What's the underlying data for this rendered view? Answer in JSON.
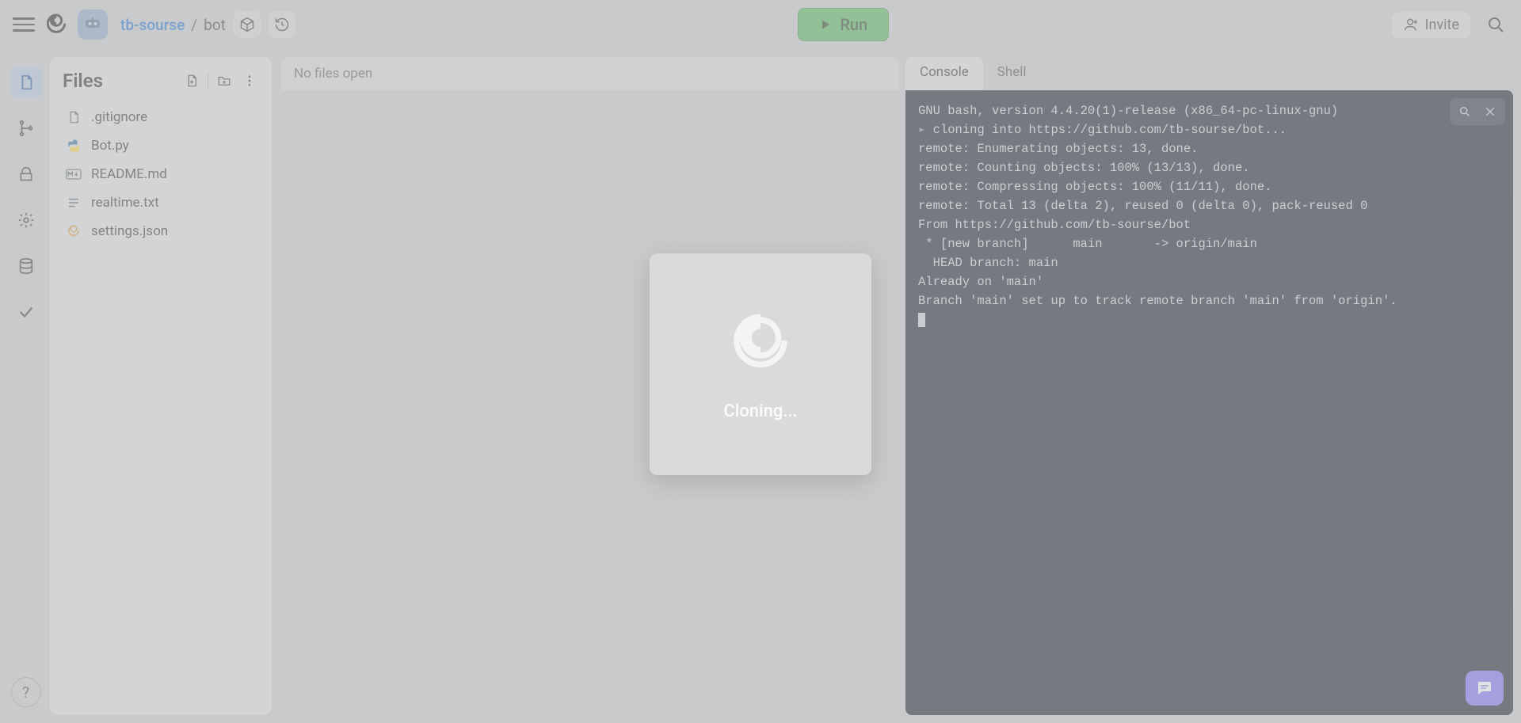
{
  "header": {
    "owner": "tb-sourse",
    "separator": "/",
    "repo": "bot",
    "run_label": "Run",
    "invite_label": "Invite"
  },
  "sidebar_rail": {
    "items": [
      "files",
      "version-control",
      "secrets",
      "settings",
      "database",
      "tests"
    ]
  },
  "files_panel": {
    "title": "Files",
    "items": [
      {
        "name": ".gitignore",
        "icon": "file"
      },
      {
        "name": "Bot.py",
        "icon": "python"
      },
      {
        "name": "README.md",
        "icon": "markdown"
      },
      {
        "name": "realtime.txt",
        "icon": "text"
      },
      {
        "name": "settings.json",
        "icon": "json"
      }
    ]
  },
  "editor": {
    "tabbar_empty": "No files open"
  },
  "right_panel": {
    "tabs": [
      {
        "label": "Console",
        "active": true
      },
      {
        "label": "Shell",
        "active": false
      }
    ],
    "console_lines": [
      "GNU bash, version 4.4.20(1)-release (x86_64-pc-linux-gnu)",
      "cloning into https://github.com/tb-sourse/bot...",
      "remote: Enumerating objects: 13, done.",
      "remote: Counting objects: 100% (13/13), done.",
      "remote: Compressing objects: 100% (11/11), done.",
      "remote: Total 13 (delta 2), reused 0 (delta 0), pack-reused 0",
      "From https://github.com/tb-sourse/bot",
      " * [new branch]      main       -> origin/main",
      "  HEAD branch: main",
      "Already on 'main'",
      "Branch 'main' set up to track remote branch 'main' from 'origin'."
    ]
  },
  "modal": {
    "text": "Cloning..."
  },
  "colors": {
    "accent_green": "#54b35a",
    "accent_blue": "#1d72d2",
    "console_bg": "#141825",
    "chat_purple": "#7d6bf5"
  }
}
